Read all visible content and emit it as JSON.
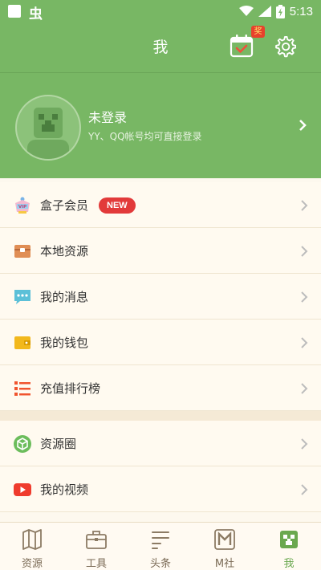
{
  "status_bar": {
    "bug_glyph": "虫",
    "time": "5:13"
  },
  "header": {
    "title": "我",
    "calendar_badge": "奖"
  },
  "profile": {
    "name": "未登录",
    "hint": "YY、QQ帐号均可直接登录"
  },
  "menu_group_1": [
    {
      "label": "盒子会员",
      "icon": "vip-icon",
      "badge": "NEW"
    },
    {
      "label": "本地资源",
      "icon": "chest-icon"
    },
    {
      "label": "我的消息",
      "icon": "message-icon"
    },
    {
      "label": "我的钱包",
      "icon": "wallet-icon"
    },
    {
      "label": "充值排行榜",
      "icon": "ranking-icon"
    }
  ],
  "menu_group_2": [
    {
      "label": "资源圈",
      "icon": "cube-icon"
    },
    {
      "label": "我的视频",
      "icon": "video-icon"
    }
  ],
  "tabbar": [
    {
      "label": "资源",
      "icon": "map-icon",
      "active": false
    },
    {
      "label": "工具",
      "icon": "toolbox-icon",
      "active": false
    },
    {
      "label": "头条",
      "icon": "news-icon",
      "active": false
    },
    {
      "label": "M社",
      "icon": "m-community-icon",
      "active": false
    },
    {
      "label": "我",
      "icon": "creeper-icon",
      "active": true
    }
  ],
  "colors": {
    "primary": "#78b764",
    "active_tab": "#6aa84f",
    "badge": "#e23a3a"
  }
}
